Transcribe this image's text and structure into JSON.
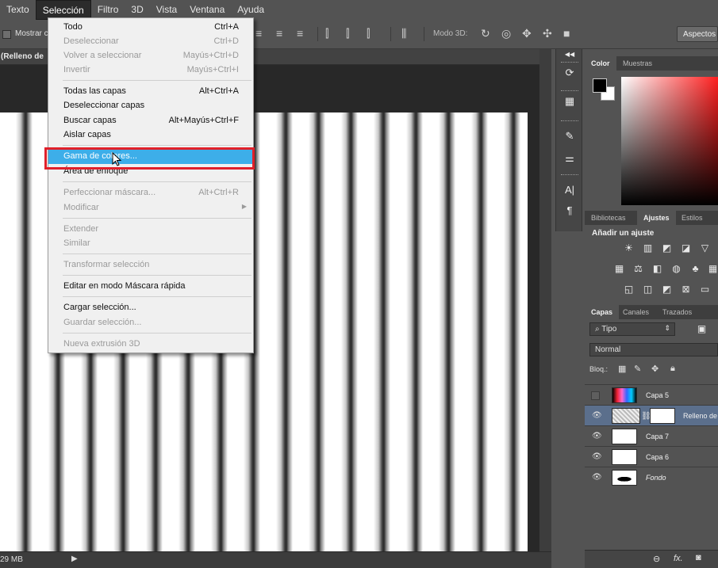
{
  "menubar": {
    "items": [
      "Texto",
      "Selección",
      "Filtro",
      "3D",
      "Vista",
      "Ventana",
      "Ayuda"
    ]
  },
  "options_bar": {
    "show_label": "Mostrar c",
    "mode3d_label": "Modo 3D:",
    "workspace_button": "Aspectos"
  },
  "document": {
    "tab_title": "(Relleno de",
    "status_size": "29 MB"
  },
  "selection_menu": {
    "items": [
      {
        "label": "Todo",
        "shortcut": "Ctrl+A",
        "disabled": false
      },
      {
        "label": "Deseleccionar",
        "shortcut": "Ctrl+D",
        "disabled": true
      },
      {
        "label": "Volver a seleccionar",
        "shortcut": "Mayús+Ctrl+D",
        "disabled": true
      },
      {
        "label": "Invertir",
        "shortcut": "Mayús+Ctrl+I",
        "disabled": true
      },
      {
        "label": "Todas las capas",
        "shortcut": "Alt+Ctrl+A",
        "disabled": false
      },
      {
        "label": "Deseleccionar capas",
        "shortcut": "",
        "disabled": false
      },
      {
        "label": "Buscar capas",
        "shortcut": "Alt+Mayús+Ctrl+F",
        "disabled": false
      },
      {
        "label": "Aislar capas",
        "shortcut": "",
        "disabled": false
      },
      {
        "label": "Gama de colores...",
        "shortcut": "",
        "disabled": false,
        "highlighted": true
      },
      {
        "label": "Área de enfoque",
        "shortcut": "",
        "disabled": false
      },
      {
        "label": "Perfeccionar máscara...",
        "shortcut": "Alt+Ctrl+R",
        "disabled": true
      },
      {
        "label": "Modificar",
        "shortcut": "",
        "disabled": true,
        "submenu": true
      },
      {
        "label": "Extender",
        "shortcut": "",
        "disabled": true
      },
      {
        "label": "Similar",
        "shortcut": "",
        "disabled": true
      },
      {
        "label": "Transformar selección",
        "shortcut": "",
        "disabled": true
      },
      {
        "label": "Editar en modo Máscara rápida",
        "shortcut": "",
        "disabled": false
      },
      {
        "label": "Cargar selección...",
        "shortcut": "",
        "disabled": false
      },
      {
        "label": "Guardar selección...",
        "shortcut": "",
        "disabled": true
      },
      {
        "label": "Nueva extrusión 3D",
        "shortcut": "",
        "disabled": true
      }
    ]
  },
  "color_panel": {
    "tabs": [
      "Color",
      "Muestras"
    ],
    "foreground": "#000000",
    "background": "#ffffff"
  },
  "adjustments_panel": {
    "tabs": [
      "Bibliotecas",
      "Ajustes",
      "Estilos"
    ],
    "title": "Añadir un ajuste"
  },
  "layers_panel": {
    "tabs": [
      "Capas",
      "Canales",
      "Trazados"
    ],
    "filter_label": "Tipo",
    "blend_mode": "Normal",
    "lock_label": "Bloq.:",
    "layers": [
      {
        "name": "Capa 5",
        "visible": false,
        "selected": false
      },
      {
        "name": "Relleno de",
        "visible": true,
        "selected": true
      },
      {
        "name": "Capa 7",
        "visible": true,
        "selected": false
      },
      {
        "name": "Capa 6",
        "visible": true,
        "selected": false
      },
      {
        "name": "Fondo",
        "visible": true,
        "selected": false
      }
    ]
  },
  "colors": {
    "highlight": "#3daee9",
    "annotation_box": "#e0202a",
    "selected_layer": "#5b6f8c"
  }
}
